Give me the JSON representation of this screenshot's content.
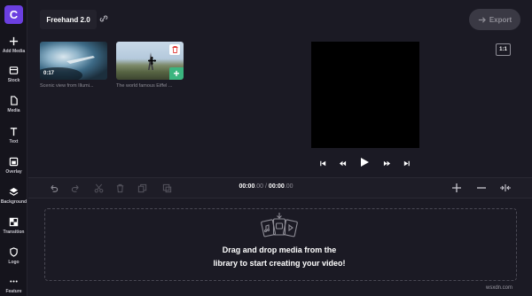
{
  "app": {
    "logo_letter": "C",
    "project_title": "Freehand 2.0",
    "export_label": "Export",
    "accent_color": "#6b3fe0",
    "add_color": "#3bb57f"
  },
  "sidebar": {
    "items": [
      {
        "label": "Add Media",
        "icon": "plus-icon"
      },
      {
        "label": "Stock",
        "icon": "stock-icon"
      },
      {
        "label": "Media",
        "icon": "file-icon"
      },
      {
        "label": "Text",
        "icon": "text-icon"
      },
      {
        "label": "Overlay",
        "icon": "overlay-icon"
      },
      {
        "label": "Background",
        "icon": "layers-icon"
      },
      {
        "label": "Transition",
        "icon": "transition-icon"
      },
      {
        "label": "Logo",
        "icon": "shield-icon"
      },
      {
        "label": "Feature",
        "icon": "more-icon"
      }
    ]
  },
  "media": {
    "items": [
      {
        "duration": "0:17",
        "caption": "Scenic view from Illumi..."
      },
      {
        "duration": "",
        "caption": "The world famous Eiffel ..."
      }
    ]
  },
  "preview": {
    "aspect_ratio": "1:1"
  },
  "timeline": {
    "current_time_main": "00:00",
    "current_time_ms": ".00",
    "separator": " / ",
    "total_time_main": "00:00",
    "total_time_ms": ".00"
  },
  "dropzone": {
    "line1": "Drag and drop media from the",
    "line2": "library to start creating your video!"
  },
  "watermark": "wsxdn.com"
}
